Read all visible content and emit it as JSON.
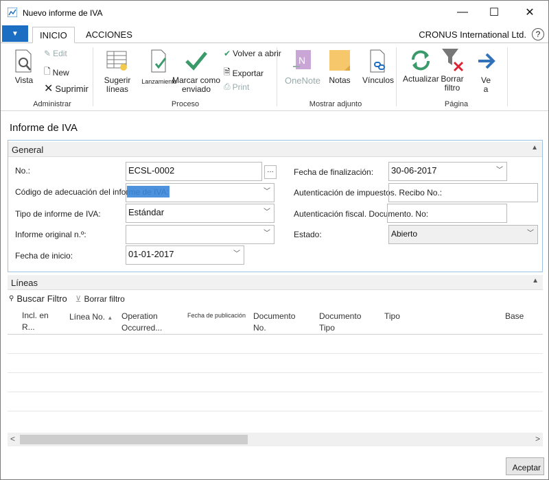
{
  "window": {
    "title": "Nuevo informe de IVA",
    "minimize": "—",
    "maximize": "☐",
    "close": "✕"
  },
  "ribbon_tabs": {
    "file": "▼",
    "tabs": [
      "INICIO",
      "ACCIONES"
    ],
    "active": "INICIO"
  },
  "company": "CRONUS International Ltd.",
  "help": "?",
  "ribbon": {
    "administrar": {
      "label": "Administrar",
      "vista": "Vista",
      "edit": "Edit",
      "new": "New",
      "suprimir": "Suprimir"
    },
    "proceso": {
      "label": "Proceso",
      "sugerir": "Sugerir líneas",
      "lanzamiento": "Lanzamiento",
      "marcar": "Marcar como enviado",
      "volver": "Volver a abrir",
      "exportar": "Exportar",
      "print": "Print"
    },
    "mostrar": {
      "label": "Mostrar adjunto",
      "onenote": "OneNote",
      "notas": "Notas",
      "vinculos": "Vínculos"
    },
    "pagina": {
      "label": "Página",
      "actualizar": "Actualizar",
      "borrar": "Borrar filtro",
      "ve": "Ve a"
    }
  },
  "page_title": "Informe de IVA",
  "general": {
    "header": "General",
    "no_label": "No.:",
    "no_value": "ECSL-0002",
    "codigo_label": "Código de adecuación del informe de IVA:",
    "codigo_value": "",
    "tipo_label": "Tipo de informe de IVA:",
    "tipo_value": "Estándar",
    "original_label": "Informe original n.º:",
    "original_value": "",
    "inicio_label": "Fecha de inicio:",
    "inicio_value": "01-01-2017",
    "fin_label": "Fecha de finalización:",
    "fin_value": "30-06-2017",
    "auth_label": "Autenticación de impuestos. Recibo No.:",
    "auth_value": "",
    "fiscal_label": "Autenticación fiscal. Documento. No:",
    "fiscal_value": "",
    "estado_label": "Estado:",
    "estado_value": "Abierto"
  },
  "lines": {
    "header": "Líneas",
    "buscar": "Buscar",
    "filtro": "Filtro",
    "borrar_filtro": "Borrar filtro",
    "columns": [
      "Incl. en R...",
      "Línea No.",
      "Operation Occurred...",
      "Fecha de publicación",
      "Documento No.",
      "Documento Tipo",
      "Tipo",
      "Base"
    ]
  },
  "accept": "Aceptar",
  "colors": {
    "accent": "#1b6ec2",
    "check": "#3a9a6a",
    "focus": "#9cc0e8"
  }
}
